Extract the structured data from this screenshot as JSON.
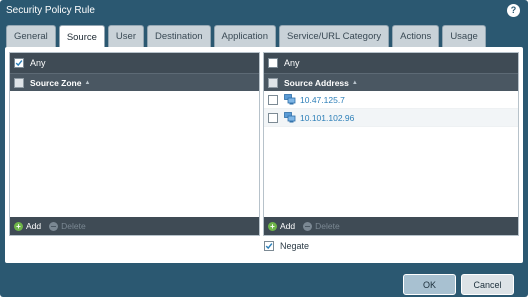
{
  "window": {
    "title": "Security Policy Rule",
    "help_icon": "?"
  },
  "tabs": [
    {
      "label": "General",
      "active": false
    },
    {
      "label": "Source",
      "active": true
    },
    {
      "label": "User",
      "active": false
    },
    {
      "label": "Destination",
      "active": false
    },
    {
      "label": "Application",
      "active": false
    },
    {
      "label": "Service/URL Category",
      "active": false
    },
    {
      "label": "Actions",
      "active": false
    },
    {
      "label": "Usage",
      "active": false
    }
  ],
  "source_zone_panel": {
    "any_label": "Any",
    "any_checked": true,
    "column_header": "Source Zone",
    "rows": [],
    "add_label": "Add",
    "delete_label": "Delete"
  },
  "source_address_panel": {
    "any_label": "Any",
    "any_checked": false,
    "column_header": "Source Address",
    "rows": [
      {
        "address": "10.47.125.7"
      },
      {
        "address": "10.101.102.96"
      }
    ],
    "add_label": "Add",
    "delete_label": "Delete"
  },
  "negate": {
    "label": "Negate",
    "checked": true
  },
  "buttons": {
    "ok": "OK",
    "cancel": "Cancel"
  },
  "colors": {
    "title_bar": "#2b5871",
    "panel_header": "#3f4b55",
    "link": "#2d7fb8",
    "add_icon": "#6fb54a"
  }
}
